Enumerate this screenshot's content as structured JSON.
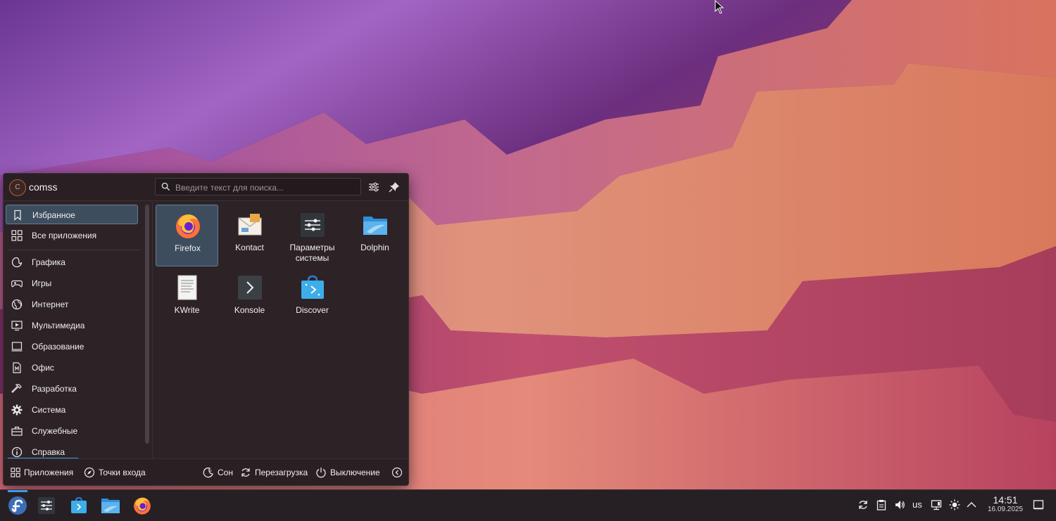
{
  "launcher": {
    "user": {
      "initial": "C",
      "name": "comss"
    },
    "search": {
      "placeholder": "Введите текст для поиска..."
    },
    "header_icons": [
      "configure-icon",
      "pin-icon"
    ],
    "sidebar": {
      "items": [
        {
          "label": "Избранное",
          "icon": "bookmark-icon",
          "active": true
        },
        {
          "label": "Все приложения",
          "icon": "grid-icon"
        },
        {
          "label": "Графика",
          "icon": "graphics-icon"
        },
        {
          "label": "Игры",
          "icon": "gamepad-icon"
        },
        {
          "label": "Интернет",
          "icon": "globe-icon"
        },
        {
          "label": "Мультимедиа",
          "icon": "multimedia-icon"
        },
        {
          "label": "Образование",
          "icon": "education-icon"
        },
        {
          "label": "Офис",
          "icon": "office-icon"
        },
        {
          "label": "Разработка",
          "icon": "hammer-icon"
        },
        {
          "label": "Система",
          "icon": "gear-icon"
        },
        {
          "label": "Служебные",
          "icon": "toolbox-icon"
        },
        {
          "label": "Справка",
          "icon": "info-icon"
        }
      ]
    },
    "favorites": [
      {
        "name": "Firefox",
        "icon": "firefox-icon",
        "active": true
      },
      {
        "name": "Kontact",
        "icon": "kontact-icon"
      },
      {
        "name": "Параметры системы",
        "icon": "system-settings-icon"
      },
      {
        "name": "Dolphin",
        "icon": "dolphin-folder-icon"
      },
      {
        "name": "KWrite",
        "icon": "kwrite-icon"
      },
      {
        "name": "Konsole",
        "icon": "konsole-icon"
      },
      {
        "name": "Discover",
        "icon": "discover-icon"
      }
    ],
    "footer": {
      "applications": "Приложения",
      "places": "Точки входа",
      "sleep": "Сон",
      "restart": "Перезагрузка",
      "shutdown": "Выключение"
    }
  },
  "taskbar": {
    "apps": [
      "fedora-launcher-icon",
      "system-settings-icon",
      "discover-icon",
      "dolphin-icon",
      "firefox-icon"
    ],
    "tray": [
      "updates-icon",
      "clipboard-icon",
      "volume-icon",
      "network-icon",
      "brightness-icon",
      "expand-tray-icon"
    ],
    "keyboard_layout": "us",
    "time": "14:51",
    "date": "16.09.2025"
  },
  "colors": {
    "accent": "#3d9ae8",
    "panel_bg": "#2d2226",
    "selection_bg": "#3e4d5e",
    "selection_border": "#5f7d98"
  }
}
